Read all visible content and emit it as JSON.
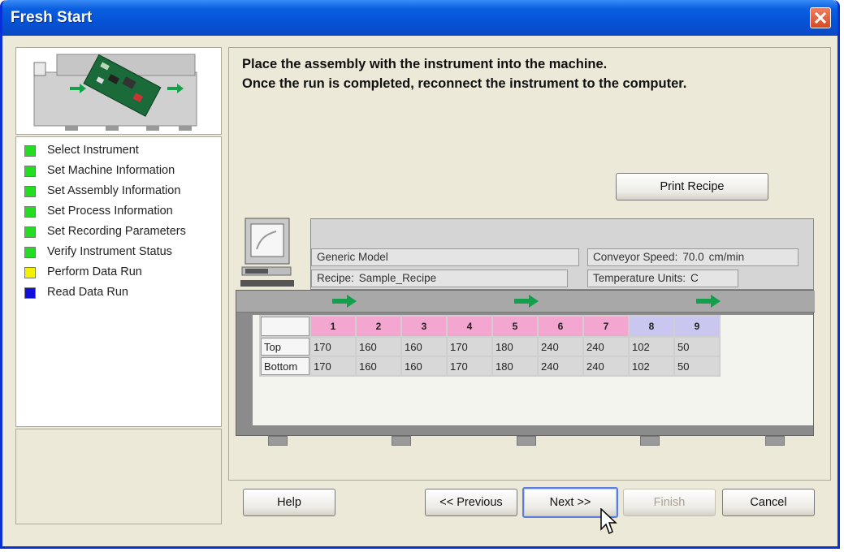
{
  "window": {
    "title": "Fresh Start"
  },
  "steps": [
    {
      "label": "Select Instrument",
      "color": "#22dd22"
    },
    {
      "label": "Set Machine Information",
      "color": "#22dd22"
    },
    {
      "label": "Set Assembly Information",
      "color": "#22dd22"
    },
    {
      "label": "Set Process Information",
      "color": "#22dd22"
    },
    {
      "label": "Set Recording Parameters",
      "color": "#22dd22"
    },
    {
      "label": "Verify Instrument Status",
      "color": "#22dd22"
    },
    {
      "label": "Perform Data Run",
      "color": "#f2f200"
    },
    {
      "label": "Read Data Run",
      "color": "#1010dd"
    }
  ],
  "instructions": {
    "line1": "Place the assembly with the instrument into the machine.",
    "line2": "Once the run is completed, reconnect the instrument to the computer."
  },
  "print_recipe_label": "Print Recipe",
  "machine": {
    "model": "Generic Model",
    "recipe_label": "Recipe:",
    "recipe_value": "Sample_Recipe",
    "conveyor_label": "Conveyor Speed:",
    "conveyor_value": "70.0",
    "conveyor_unit": "cm/min",
    "temp_units_label": "Temperature Units:",
    "temp_units_value": "C"
  },
  "zones": {
    "headers": [
      "1",
      "2",
      "3",
      "4",
      "5",
      "6",
      "7",
      "8",
      "9"
    ],
    "header_colors": [
      "pink",
      "pink",
      "pink",
      "pink",
      "pink",
      "pink",
      "pink",
      "lav",
      "lav"
    ],
    "rows": [
      {
        "label": "Top",
        "values": [
          "170",
          "160",
          "160",
          "170",
          "180",
          "240",
          "240",
          "102",
          "50"
        ]
      },
      {
        "label": "Bottom",
        "values": [
          "170",
          "160",
          "160",
          "170",
          "180",
          "240",
          "240",
          "102",
          "50"
        ]
      }
    ]
  },
  "buttons": {
    "help": "Help",
    "previous": "<< Previous",
    "next": "Next >>",
    "finish": "Finish",
    "cancel": "Cancel"
  },
  "colors": {
    "titlebar": "#0553d6",
    "arrow": "#14a04a",
    "dialog_bg": "#ece9d8"
  }
}
